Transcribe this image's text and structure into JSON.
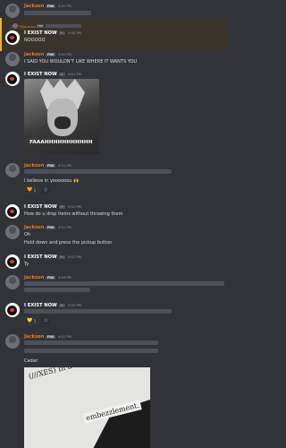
{
  "colors": {
    "background": "#313338",
    "jackson_name": "#e67e22",
    "text": "#dbdee1",
    "muted": "#949ba4"
  },
  "messages": [
    {
      "author": "Jackson",
      "tag": "FBK",
      "time": "6:50 PM"
    },
    {
      "reply_author": "@Jackson",
      "reply_tag": "FBK",
      "author": "I EXIST NOW",
      "tag": "",
      "time": "6:50 PM",
      "text": "NOOOOO"
    },
    {
      "author": "Jackson",
      "tag": "FBK",
      "time": "6:50 PM",
      "text": "I SAID YOU WOULDN'T LIKE WHERE IT WANTS YOU"
    },
    {
      "author": "I EXIST NOW",
      "tag": "",
      "time": "6:51 PM",
      "gif_caption": "FAAAHHHHHHHHHHH"
    },
    {
      "author": "Jackson",
      "tag": "FBK",
      "time": "6:51 PM",
      "text": "I believe in yoooooou 🙌",
      "reaction_emoji": "🧡",
      "reaction_count": "1"
    },
    {
      "author": "I EXIST NOW",
      "tag": "",
      "time": "6:51 PM",
      "text": "How do u drop items without throwing them"
    },
    {
      "author": "Jackson",
      "tag": "FBK",
      "time": "6:51 PM",
      "text1": "Oh",
      "text2": "Hold down and press the pickup button"
    },
    {
      "author": "I EXIST NOW",
      "tag": "",
      "time": "6:51 PM",
      "text": "Ty"
    },
    {
      "author": "Jackson",
      "tag": "FBK",
      "time": "6:59 PM"
    },
    {
      "author": "I EXIST NOW",
      "tag": "",
      "time": "6:53 PM",
      "reaction_emoji": "💛",
      "reaction_count": "1"
    },
    {
      "author": "Jackson",
      "tag": "FBK",
      "time": "6:51 PM",
      "text": "Cadar:",
      "photo_line1": "(///XES) In a ruling last",
      "photo_line2": "embezzlement."
    }
  ],
  "icons": {
    "add_reaction": "smiley-plus-icon"
  }
}
